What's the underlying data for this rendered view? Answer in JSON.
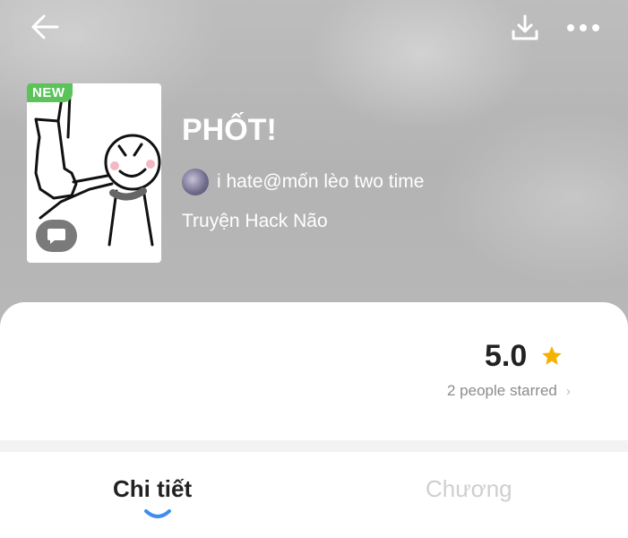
{
  "header": {
    "back_icon": "arrow-left-icon",
    "download_icon": "download-icon",
    "more_icon": "more-horizontal-icon"
  },
  "story": {
    "badge": "NEW",
    "title": "PHỐT!",
    "author": "i hate@mốn lèo two time",
    "genre": "Truyện Hack Não"
  },
  "rating": {
    "value": "5.0",
    "star_color": "#f5b301",
    "starred_text": "2 people starred",
    "chevron": "›"
  },
  "tabs": [
    {
      "label": "Chi tiết",
      "active": true
    },
    {
      "label": "Chương",
      "active": false
    }
  ],
  "colors": {
    "accent": "#3d8ef0",
    "badge_green": "#5bc35a"
  }
}
